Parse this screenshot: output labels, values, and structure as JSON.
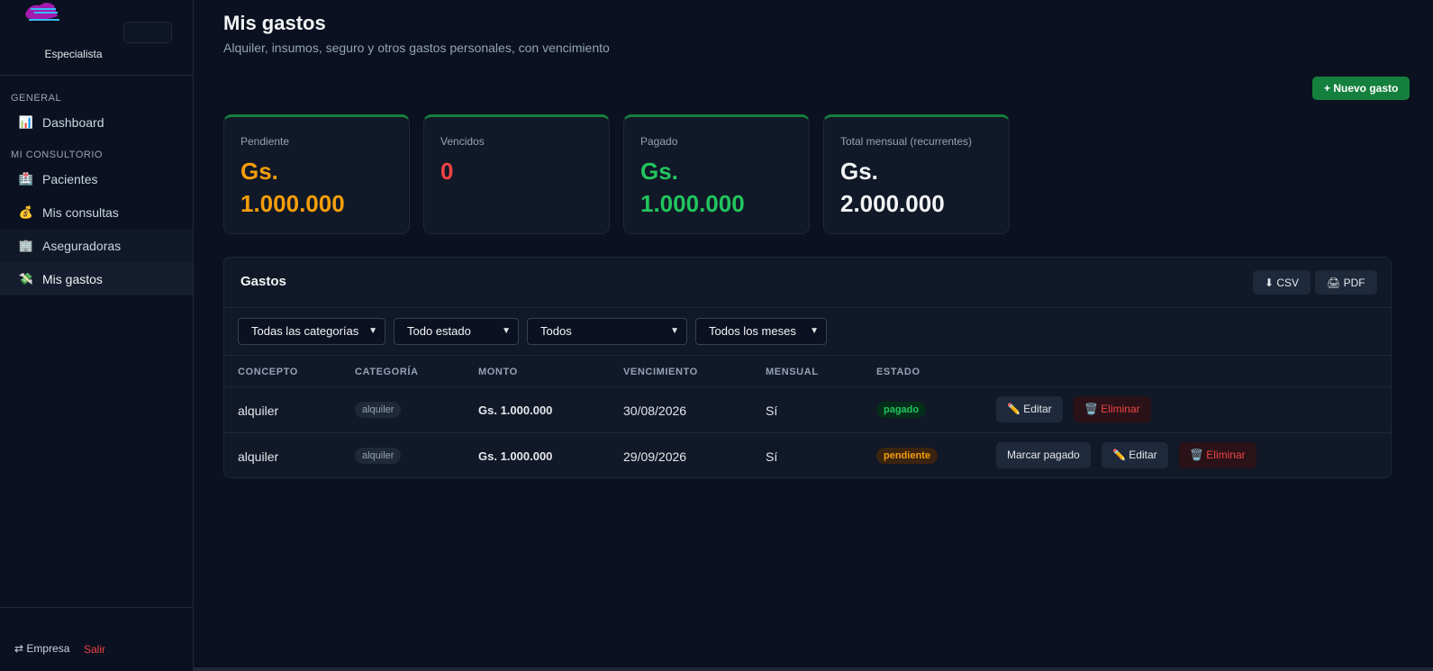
{
  "sidebar": {
    "role": "Especialista",
    "sections": [
      {
        "label": "GENERAL"
      },
      {
        "label": "MI CONSULTORIO"
      }
    ],
    "items": [
      {
        "icon": "📊",
        "label": "Dashboard"
      },
      {
        "icon": "🏥",
        "label": "Pacientes"
      },
      {
        "icon": "💰",
        "label": "Mis consultas"
      },
      {
        "icon": "🏢",
        "label": "Aseguradoras"
      },
      {
        "icon": "💸",
        "label": "Mis gastos"
      }
    ],
    "footer": {
      "empresa": "⇄ Empresa",
      "salir": "Salir"
    }
  },
  "header": {
    "title": "Mis gastos",
    "subtitle": "Alquiler, insumos, seguro y otros gastos personales, con vencimiento",
    "new_button": "+ Nuevo gasto"
  },
  "cards": [
    {
      "label": "Pendiente",
      "value_line1": "Gs.",
      "value_line2": "1.000.000",
      "color": "#f59e0b"
    },
    {
      "label": "Vencidos",
      "value_line1": "0",
      "value_line2": "",
      "color": "#ef4444"
    },
    {
      "label": "Pagado",
      "value_line1": "Gs.",
      "value_line2": "1.000.000",
      "color": "#22c55e"
    },
    {
      "label": "Total mensual (recurrentes)",
      "value_line1": "Gs.",
      "value_line2": "2.000.000",
      "color": "#f3f4f6"
    }
  ],
  "panel": {
    "title": "Gastos",
    "csv_button": "⬇ CSV",
    "pdf_button": "🖨 PDF",
    "filters": {
      "categoria": "Todas las categorías",
      "estado": "Todo estado",
      "tipo": "Todos",
      "mes": "Todos los meses"
    },
    "columns": [
      "CONCEPTO",
      "CATEGORÍA",
      "MONTO",
      "VENCIMIENTO",
      "MENSUAL",
      "ESTADO"
    ],
    "rows": [
      {
        "concepto": "alquiler",
        "categoria": "alquiler",
        "monto": "Gs. 1.000.000",
        "vencimiento": "30/08/2026",
        "mensual": "Sí",
        "estado": "pagado"
      },
      {
        "concepto": "alquiler",
        "categoria": "alquiler",
        "monto": "Gs. 1.000.000",
        "vencimiento": "29/09/2026",
        "mensual": "Sí",
        "estado": "pendiente"
      }
    ],
    "actions": {
      "mark_paid": "Marcar pagado",
      "edit": "✏️ Editar",
      "delete": "🗑️ Eliminar"
    }
  }
}
